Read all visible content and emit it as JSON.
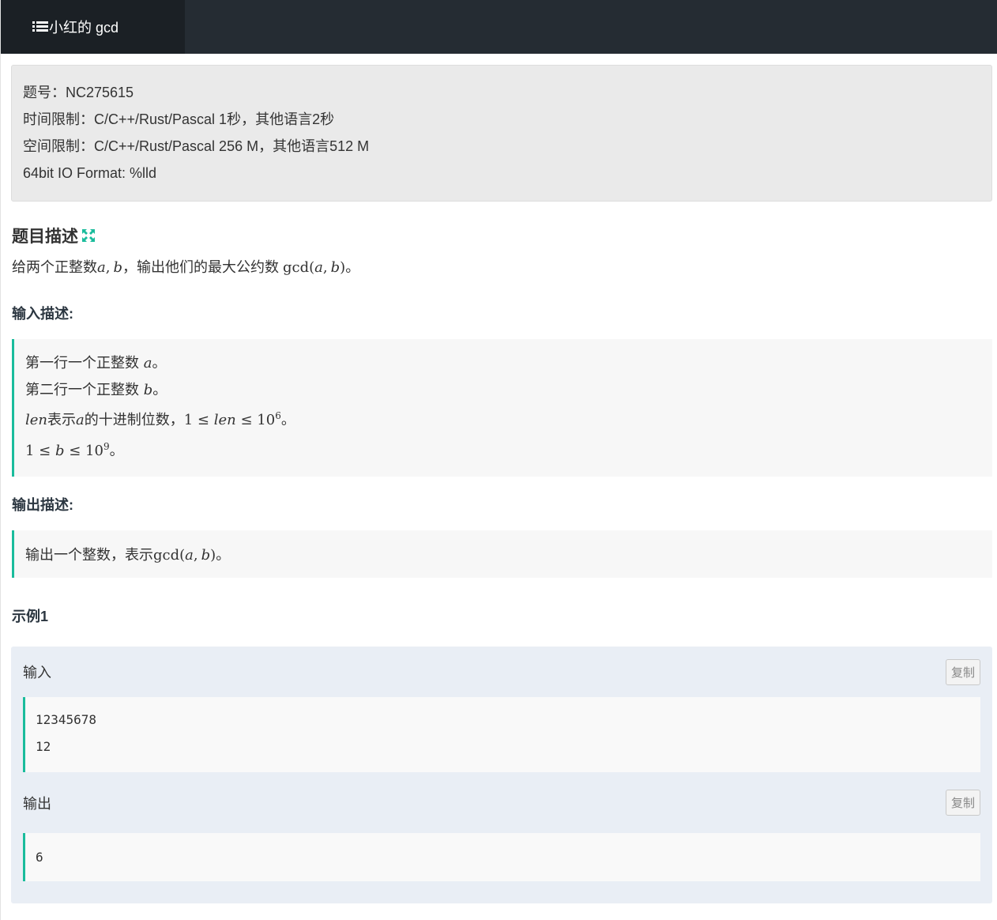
{
  "tab": {
    "title": "小红的 gcd",
    "icon": "list-icon"
  },
  "info": {
    "problem_id": "题号：NC275615",
    "time_limit": "时间限制：C/C++/Rust/Pascal 1秒，其他语言2秒",
    "memory_limit": "空间限制：C/C++/Rust/Pascal 256 M，其他语言512 M",
    "io_format": "64bit IO Format: %lld"
  },
  "description": {
    "title": "题目描述",
    "expand_icon": "expand-icon",
    "text_prefix": "给两个正整数",
    "var_a": "a",
    "comma": ",",
    "var_b": "b",
    "text_mid": "，输出他们的最大公约数 ",
    "gcd": "gcd",
    "paren_open": "(",
    "paren_close": ")",
    "text_end": "。"
  },
  "input_desc": {
    "title": "输入描述:",
    "line1_text": "第一行一个正整数 ",
    "line1_var": "a",
    "line2_text": "第二行一个正整数 ",
    "line2_var": "b",
    "line3_var": "len",
    "line3_text": "表示",
    "line3_var2": "a",
    "line3_text2": "的十进制位数，",
    "line3_math": "1 ≤ ",
    "line3_math_var": "len",
    "line3_math2": " ≤ 10",
    "line3_exp": "6",
    "line4_math": "1 ≤ ",
    "line4_var": "b",
    "line4_math2": " ≤ 10",
    "line4_exp": "9",
    "period": "。"
  },
  "output_desc": {
    "title": "输出描述:",
    "text": "输出一个整数，表示",
    "gcd": "gcd",
    "var_a": "a",
    "var_b": "b"
  },
  "example": {
    "title": "示例1",
    "input_label": "输入",
    "output_label": "输出",
    "copy_label": "复制",
    "input_lines": [
      "12345678",
      "12"
    ],
    "output_lines": [
      "6"
    ]
  },
  "colors": {
    "accent": "#1abc9c",
    "topbar": "#252c33",
    "tab_active": "#1b2025"
  }
}
